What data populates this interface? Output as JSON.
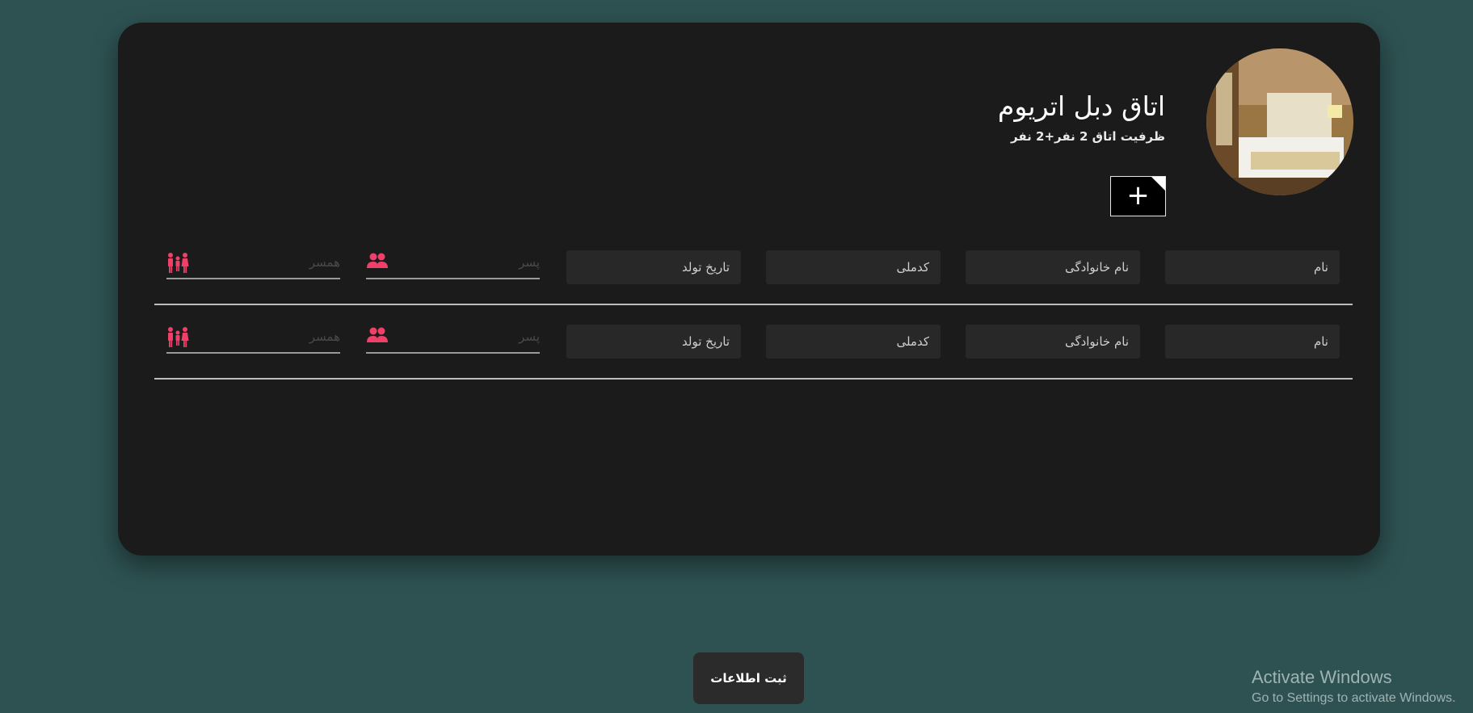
{
  "room": {
    "title": "اتاق دبل اتریوم",
    "capacity": "ظرفیت اتاق 2 نفر+2 نفر",
    "add_label": "+"
  },
  "guest_rows": [
    {
      "name_placeholder": "نام",
      "family_placeholder": "نام خانوادگی",
      "national_code_placeholder": "کدملی",
      "birth_date_placeholder": "تاریخ تولد",
      "boy_placeholder": "پسر",
      "spouse_placeholder": "همسر"
    },
    {
      "name_placeholder": "نام",
      "family_placeholder": "نام خانوادگی",
      "national_code_placeholder": "کدملی",
      "birth_date_placeholder": "تاریخ تولد",
      "boy_placeholder": "پسر",
      "spouse_placeholder": "همسر"
    }
  ],
  "submit_label": "ثبت اطلاعات",
  "watermark": {
    "title": "Activate Windows",
    "subtitle": "Go to Settings to activate Windows."
  },
  "icons": {
    "boy": "group-people-icon",
    "spouse": "family-icon",
    "accent_color": "#f0406a"
  }
}
